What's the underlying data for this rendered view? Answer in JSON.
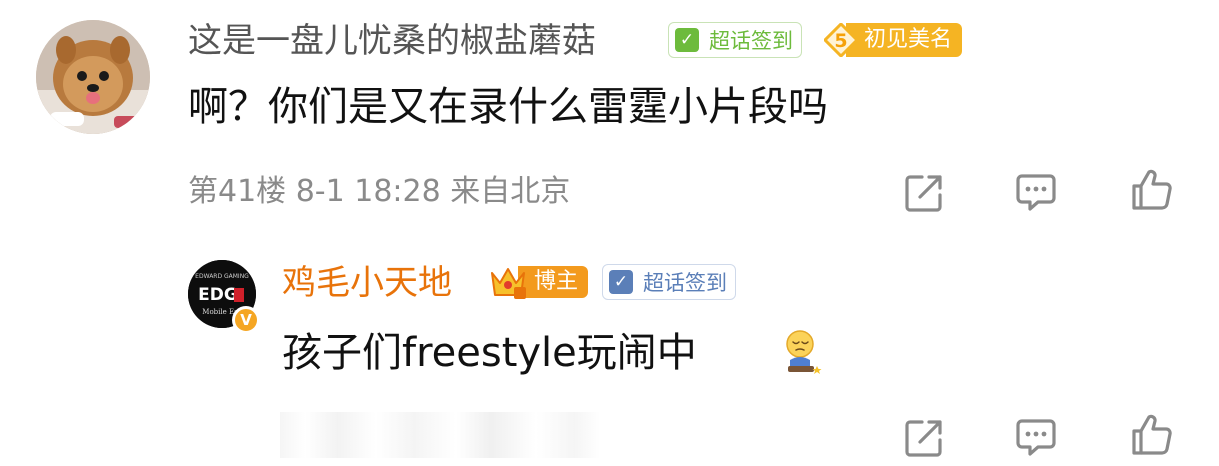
{
  "comment": {
    "username": "这是一盘儿忧桑的椒盐蘑菇",
    "badge_checkin": {
      "label": "超话签到",
      "color": "#6dbb3c"
    },
    "badge_level": {
      "level": "5",
      "label": "初见美名",
      "color": "#f5b423"
    },
    "text": "啊？你们是又在录什么雷霆小片段吗",
    "meta": "第41楼  8-1 18:28  来自北京",
    "icons": {
      "share": "share-icon",
      "comment": "comment-icon",
      "like": "thumbs-up-icon"
    }
  },
  "reply": {
    "username": "鸡毛小天地",
    "username_color": "#e8730a",
    "badge_author": {
      "label": "博主",
      "color": "#f39a1d"
    },
    "badge_checkin": {
      "label": "超话签到",
      "color": "#5b7fb8"
    },
    "verified_mark": "V",
    "avatar_text": {
      "top": "EDWARD GAMING",
      "logo": "EDG",
      "bottom": "Mobile Es"
    },
    "text": "孩子们freestyle玩闹中",
    "emoji": "tired-emoji",
    "icons": {
      "share": "share-icon",
      "comment": "comment-icon",
      "like": "thumbs-up-icon"
    }
  }
}
